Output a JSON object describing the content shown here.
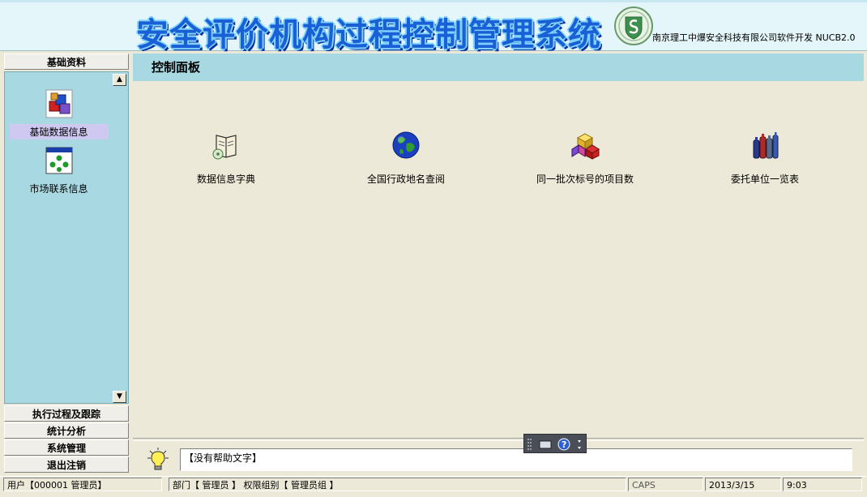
{
  "app": {
    "title": "安全评价机构过程控制管理系统",
    "company": "南京理工中爆安全科技有限公司软件开发 NUCB2.0"
  },
  "sidebar": {
    "groups": [
      {
        "label": "基础资料"
      },
      {
        "label": "执行过程及跟踪"
      },
      {
        "label": "统计分析"
      },
      {
        "label": "系统管理"
      },
      {
        "label": "退出注销"
      }
    ],
    "items": [
      {
        "label": "基础数据信息",
        "icon": "database-blocks-icon"
      },
      {
        "label": "市场联系信息",
        "icon": "network-window-icon"
      }
    ],
    "scroll_up": "▲",
    "scroll_down": "▼"
  },
  "main": {
    "title": "控制面板",
    "tiles": [
      {
        "label": "数据信息字典",
        "icon": "book-cd-icon"
      },
      {
        "label": "全国行政地名查阅",
        "icon": "globe-icon"
      },
      {
        "label": "同一批次标号的项目数",
        "icon": "colored-cubes-icon"
      },
      {
        "label": "委托单位一览表",
        "icon": "bottles-icon"
      }
    ]
  },
  "help": {
    "text": "【没有帮助文字】"
  },
  "status": {
    "user": "用户【000001 管理员】",
    "dept": "部门【 管理员  】 权限组别【 管理员组  】",
    "caps": "CAPS",
    "date": "2013/3/15",
    "time": "9:03"
  },
  "colors": {
    "panel_blue": "#a8d8e2",
    "title_blue": "#1a5fd6",
    "background": "#ece9d8"
  }
}
